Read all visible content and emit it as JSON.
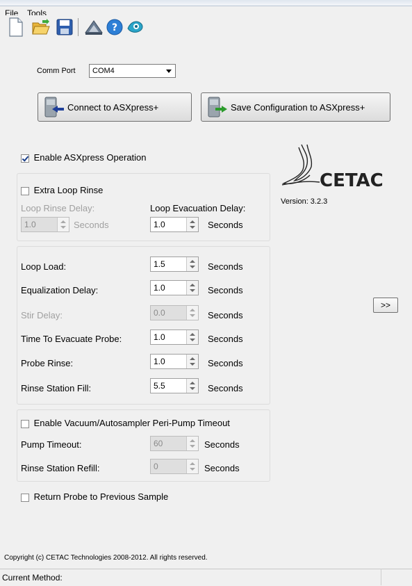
{
  "menu": [
    "File",
    "Tools"
  ],
  "toolbar": {
    "icons": [
      "new-file-icon",
      "open-folder-icon",
      "save-disk-icon",
      "document-tool-icon",
      "help-icon",
      "about-icon"
    ]
  },
  "comm_port": {
    "label": "Comm Port",
    "value": "COM4"
  },
  "buttons": {
    "connect": "Connect to ASXpress+",
    "save_config": "Save Configuration to ASXpress+",
    "expand": ">>"
  },
  "enable_asxpress": {
    "label": "Enable ASXpress Operation",
    "checked": true
  },
  "brand": {
    "logo_text": "CETAC",
    "version": "Version: 3.2.3"
  },
  "extra_loop": {
    "label": "Extra Loop Rinse",
    "checked": false,
    "loop_rinse_delay": {
      "label": "Loop Rinse Delay:",
      "value": "1.0",
      "unit": "Seconds"
    },
    "loop_evacuation_delay": {
      "label": "Loop Evacuation Delay:",
      "value": "1.0",
      "unit": "Seconds"
    }
  },
  "timing": [
    {
      "label": "Loop Load:",
      "value": "1.5",
      "unit": "Seconds",
      "disabled": false
    },
    {
      "label": "Equalization Delay:",
      "value": "1.0",
      "unit": "Seconds",
      "disabled": false
    },
    {
      "label": "Stir Delay:",
      "value": "0.0",
      "unit": "Seconds",
      "disabled": true
    },
    {
      "label": "Time To Evacuate Probe:",
      "value": "1.0",
      "unit": "Seconds",
      "disabled": false
    },
    {
      "label": "Probe Rinse:",
      "value": "1.0",
      "unit": "Seconds",
      "disabled": false
    },
    {
      "label": "Rinse Station Fill:",
      "value": "5.5",
      "unit": "Seconds",
      "disabled": false
    }
  ],
  "vacuum": {
    "label": "Enable Vacuum/Autosampler Peri-Pump Timeout",
    "checked": false,
    "pump_timeout": {
      "label": "Pump Timeout:",
      "value": "60",
      "unit": "Seconds"
    },
    "rinse_station_refill": {
      "label": "Rinse Station Refill:",
      "value": "0",
      "unit": "Seconds"
    }
  },
  "return_probe": {
    "label": "Return Probe to Previous Sample",
    "checked": false
  },
  "copyright": "Copyright (c) CETAC Technologies 2008-2012. All rights reserved.",
  "status": {
    "current_method_label": "Current Method:"
  }
}
